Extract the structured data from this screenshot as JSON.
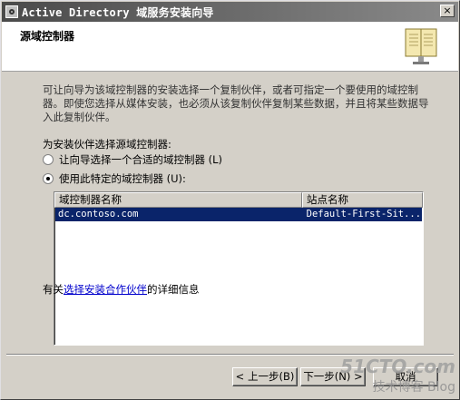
{
  "window": {
    "title": "Active Directory 域服务安装向导",
    "close_glyph": "×"
  },
  "header": {
    "title": "源域控制器"
  },
  "description": "可让向导为该域控制器的安装选择一个复制伙伴，或者可指定一个要使用的域控制器。即使您选择从媒体安装，也必须从该复制伙伴复制某些数据，并且将某些数据导入此复制伙伴。",
  "select_label": "为安装伙伴选择源域控制器:",
  "options": [
    {
      "label": "让向导选择一个合适的域控制器 (L)",
      "checked": false
    },
    {
      "label": "使用此特定的域控制器 (U):",
      "checked": true
    }
  ],
  "table": {
    "columns": [
      "域控制器名称",
      "站点名称"
    ],
    "rows": [
      {
        "dc": "dc.contoso.com",
        "site": "Default-First-Sit..."
      }
    ]
  },
  "more_info": {
    "prefix": "有关",
    "link": "选择安装合作伙伴",
    "suffix": "的详细信息"
  },
  "buttons": {
    "back": "< 上一步(B)",
    "next": "下一步(N) >",
    "cancel": "取消"
  },
  "watermark": {
    "main": "51CTO.com",
    "sub": "技术博客 Blog"
  }
}
